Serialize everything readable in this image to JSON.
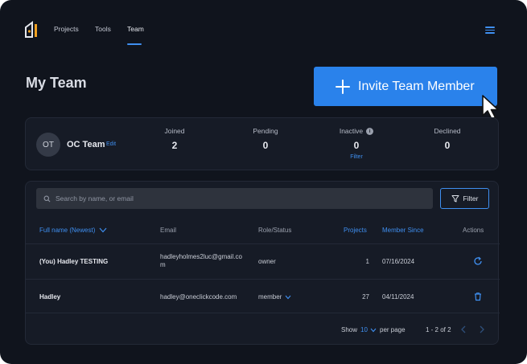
{
  "nav": {
    "items": [
      "Projects",
      "Tools",
      "Team"
    ],
    "active": "Team"
  },
  "page": {
    "title": "My Team"
  },
  "invite": {
    "label": "Invite Team Member"
  },
  "team": {
    "initials": "OT",
    "name": "OC Team",
    "edit_label": "Edit"
  },
  "stats": {
    "joined": {
      "label": "Joined",
      "value": "2"
    },
    "pending": {
      "label": "Pending",
      "value": "0"
    },
    "inactive": {
      "label": "Inactive",
      "value": "0",
      "filter_label": "Filter",
      "info": "i"
    },
    "declined": {
      "label": "Declined",
      "value": "0"
    }
  },
  "search": {
    "placeholder": "Search by name, or email"
  },
  "filter_button": {
    "label": "Filter"
  },
  "table": {
    "headers": {
      "name": "Full name (Newest)",
      "email": "Email",
      "role": "Role/Status",
      "projects": "Projects",
      "member_since": "Member Since",
      "actions": "Actions"
    },
    "rows": [
      {
        "name": "(You) Hadley TESTING",
        "email": "hadleyholmes2luc@gmail.com",
        "role": "owner",
        "projects": "1",
        "member_since": "07/16/2024",
        "action_icon": "refresh-icon"
      },
      {
        "name": "Hadley",
        "email": "hadley@oneclickcode.com",
        "role": "member",
        "projects": "27",
        "member_since": "04/11/2024",
        "action_icon": "trash-icon"
      }
    ]
  },
  "pagination": {
    "show_label": "Show",
    "page_size": "10",
    "per_page_label": "per page",
    "range": "1 - 2 of 2"
  },
  "colors": {
    "accent": "#2a82eb",
    "background": "#10141d",
    "card": "#161b26"
  }
}
